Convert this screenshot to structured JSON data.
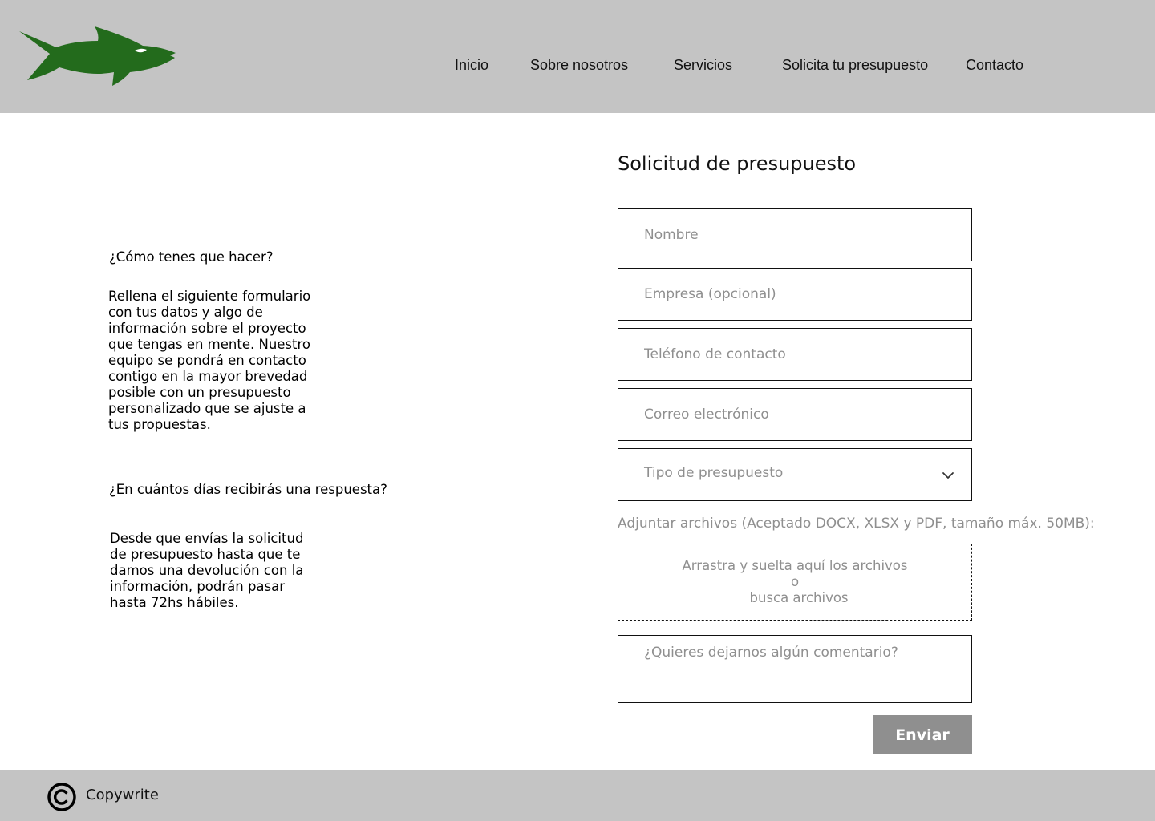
{
  "header": {
    "logo_name": "shark-logo",
    "logo_color": "#236b1c",
    "nav": [
      {
        "label": "Inicio"
      },
      {
        "label": "Sobre nosotros"
      },
      {
        "label": "Servicios"
      },
      {
        "label": "Solicita tu presupuesto"
      },
      {
        "label": "Contacto"
      }
    ]
  },
  "info": {
    "q1_title": "¿Cómo tenes que hacer?",
    "q1_lines": [
      "Rellena el siguiente formulario",
      "con tus datos y algo de",
      "información sobre el proyecto",
      "que tengas en mente. Nuestro",
      "equipo se pondrá en contacto",
      "contigo en la mayor brevedad",
      "posible con un presupuesto",
      "personalizado que se ajuste a",
      "tus propuestas."
    ],
    "q2_title": "¿En cuántos días recibirás una respuesta?",
    "q2_lines": [
      "Desde que envías la solicitud",
      "de presupuesto hasta que te",
      "damos una devolución con la",
      "información, podrán pasar",
      "hasta 72hs hábiles."
    ]
  },
  "form": {
    "title": "Solicitud de presupuesto",
    "name_placeholder": "Nombre",
    "company_placeholder": "Empresa (opcional)",
    "phone_placeholder": "Teléfono de contacto",
    "email_placeholder": "Correo electrónico",
    "type_placeholder": "Tipo de presupuesto",
    "attach_label": "Adjuntar archivos (Aceptado DOCX, XLSX y PDF, tamaño máx. 50MB):",
    "dropzone_line1": "Arrastra y suelta aquí los archivos",
    "dropzone_or": "o",
    "dropzone_browse": "busca archivos",
    "comment_placeholder": "¿Quieres dejarnos algún comentario?",
    "submit_label": "Enviar"
  },
  "footer": {
    "icon": "copyright-icon",
    "text": "Copywrite"
  },
  "colors": {
    "header_bg": "#c4c4c4",
    "footer_bg": "#c4c4c4",
    "button_bg": "#8f8f8f",
    "placeholder": "#8f8f8f",
    "logo": "#236b1c"
  }
}
